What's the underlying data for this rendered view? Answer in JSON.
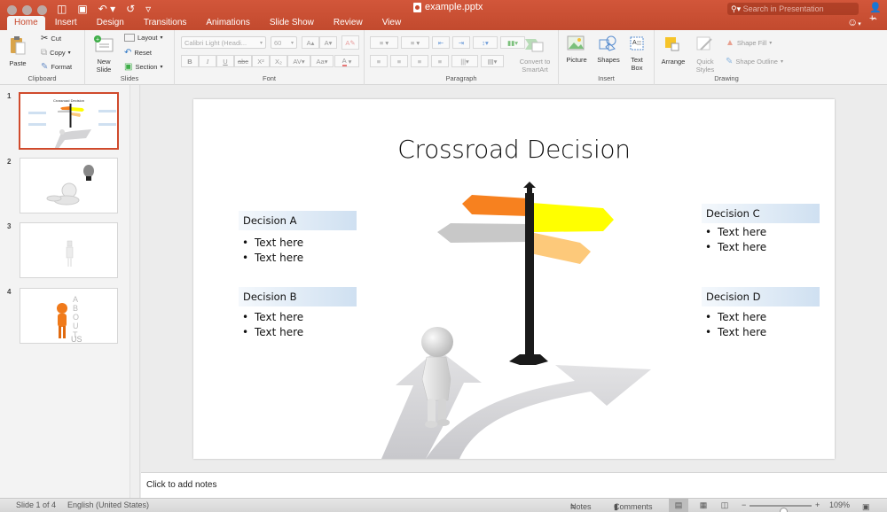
{
  "window": {
    "title": "example.pptx",
    "search_placeholder": "Search in Presentation",
    "qat": {
      "save": "▣",
      "undo": "↶ ▾",
      "redo": "↺",
      "customize": "▿"
    }
  },
  "tabs": [
    {
      "label": "Home",
      "active": true
    },
    {
      "label": "Insert"
    },
    {
      "label": "Design"
    },
    {
      "label": "Transitions"
    },
    {
      "label": "Animations"
    },
    {
      "label": "Slide Show"
    },
    {
      "label": "Review"
    },
    {
      "label": "View"
    }
  ],
  "ribbon": {
    "clipboard": {
      "label": "Clipboard",
      "paste": "Paste",
      "cut": "Cut",
      "copy": "Copy",
      "format": "Format"
    },
    "slides": {
      "label": "Slides",
      "new_slide": "New Slide",
      "layout": "Layout",
      "reset": "Reset",
      "section": "Section"
    },
    "font": {
      "label": "Font",
      "font_name": "Calibri Light (Headi...",
      "font_size": "60",
      "bold": "B",
      "italic": "I",
      "underline": "U",
      "strike": "abc",
      "superscript": "X²",
      "subscript": "X₂"
    },
    "paragraph": {
      "label": "Paragraph",
      "convert_smartart": "Convert to SmartArt"
    },
    "insert": {
      "label": "Insert",
      "picture": "Picture",
      "shapes": "Shapes",
      "text_box": "Text Box"
    },
    "drawing": {
      "label": "Drawing",
      "arrange": "Arrange",
      "quick_styles": "Quick Styles",
      "shape_fill": "Shape Fill",
      "shape_outline": "Shape Outline"
    }
  },
  "thumbnails": [
    {
      "number": "1",
      "selected": true,
      "mini_title": "Crossroad Decision"
    },
    {
      "number": "2"
    },
    {
      "number": "3"
    },
    {
      "number": "4",
      "letters": "ABOUTUS"
    }
  ],
  "slide": {
    "title": "Crossroad Decision",
    "decisions": [
      {
        "heading": "Decision A",
        "bullets": [
          "Text here",
          "Text here"
        ]
      },
      {
        "heading": "Decision B",
        "bullets": [
          "Text here",
          "Text here"
        ]
      },
      {
        "heading": "Decision C",
        "bullets": [
          "Text here",
          "Text here"
        ]
      },
      {
        "heading": "Decision D",
        "bullets": [
          "Text here",
          "Text here"
        ]
      }
    ],
    "sign_colors": {
      "orange": "#f7811f",
      "yellow": "#ffff00",
      "light_orange": "#fdc97a",
      "gray": "#c8c8c8",
      "post": "#1a1a1a"
    }
  },
  "notes": {
    "placeholder": "Click to add notes"
  },
  "status": {
    "slide_counter": "Slide 1 of 4",
    "language": "English (United States)",
    "notes_label": "Notes",
    "comments_label": "Comments",
    "zoom_level": "109%",
    "zoom_fraction": 0.55
  },
  "accent_color": "#c8482c"
}
